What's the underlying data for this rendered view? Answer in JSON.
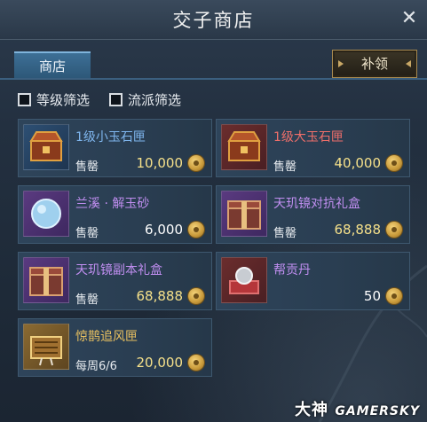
{
  "window": {
    "title": "交子商店",
    "close_icon": "close-icon"
  },
  "tabs": [
    {
      "label": "商店",
      "active": true
    }
  ],
  "claim_button": {
    "label": "补领"
  },
  "filters": [
    {
      "label": "等级筛选",
      "checked": false
    },
    {
      "label": "流派筛选",
      "checked": false
    }
  ],
  "items": [
    {
      "name": "1级小玉石匣",
      "label": "售罄",
      "price": "10,000",
      "rarity": "blue",
      "icon": "jade-chest-icon"
    },
    {
      "name": "1级大玉石匣",
      "label": "售罄",
      "price": "40,000",
      "rarity": "red",
      "icon": "jade-chest-icon"
    },
    {
      "name": "兰溪 · 解玉砂",
      "label": "售罄",
      "price": "6,000",
      "rarity": "purple",
      "icon": "jade-sand-icon"
    },
    {
      "name": "天玑镜对抗礼盒",
      "label": "售罄",
      "price": "68,888",
      "rarity": "purple",
      "icon": "gift-box-icon"
    },
    {
      "name": "天玑镜副本礼盒",
      "label": "售罄",
      "price": "68,888",
      "rarity": "purple",
      "icon": "gift-box-icon"
    },
    {
      "name": "帮贡丹",
      "label": "",
      "price": "50",
      "rarity": "red",
      "icon": "pill-icon"
    },
    {
      "name": "惊鹊追风匣",
      "label": "每周6/6",
      "price": "20,000",
      "rarity": "gold",
      "icon": "wind-chest-icon"
    }
  ],
  "currency_icon": "coin-icon",
  "colors": {
    "accent": "#3d6f96",
    "price": "#f5e08a",
    "blue_name": "#7fb6ee",
    "red_name": "#ef6f6a",
    "purple_name": "#c08ef0",
    "gold_name": "#e8c060"
  },
  "watermark": {
    "text": "大神",
    "sub": "GAMERSKY"
  }
}
